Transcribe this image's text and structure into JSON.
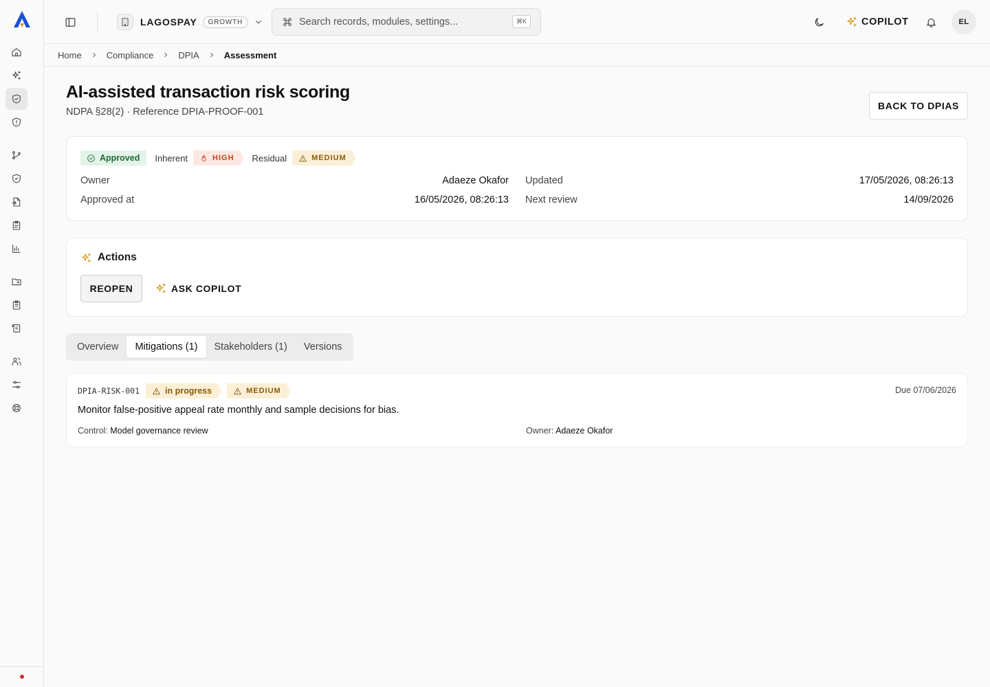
{
  "topbar": {
    "org_name": "LAGOSPAY",
    "org_plan": "GROWTH",
    "search_placeholder": "Search records, modules, settings...",
    "search_shortcut": "⌘K",
    "copilot_label": "COPILOT",
    "avatar_initials": "EL"
  },
  "breadcrumb": [
    "Home",
    "Compliance",
    "DPIA",
    "Assessment"
  ],
  "page": {
    "title": "AI-assisted transaction risk scoring",
    "subtitle": "NDPA §28(2) · Reference DPIA-PROOF-001",
    "back_label": "BACK TO DPIAS"
  },
  "summary": {
    "status": "Approved",
    "inherent_label": "Inherent",
    "inherent_value": "HIGH",
    "residual_label": "Residual",
    "residual_value": "MEDIUM",
    "owner_label": "Owner",
    "owner_value": "Adaeze Okafor",
    "updated_label": "Updated",
    "updated_value": "17/05/2026, 08:26:13",
    "approved_label": "Approved at",
    "approved_value": "16/05/2026, 08:26:13",
    "review_label": "Next review",
    "review_value": "14/09/2026"
  },
  "actions": {
    "title": "Actions",
    "reopen_label": "REOPEN",
    "ask_label": "ASK COPILOT"
  },
  "tabs": [
    "Overview",
    "Mitigations (1)",
    "Stakeholders (1)",
    "Versions"
  ],
  "active_tab": "Mitigations (1)",
  "mitigation": {
    "code": "DPIA-RISK-001",
    "status": "in progress",
    "severity": "MEDIUM",
    "due": "Due 07/06/2026",
    "description": "Monitor false-positive appeal rate monthly and sample decisions for bias.",
    "control_label": "Control:",
    "control_value": "Model governance review",
    "owner_label": "Owner:",
    "owner_value": "Adaeze Okafor"
  },
  "colors": {
    "brand_blue": "#1d4fd8",
    "brand_gold": "#d89a1c",
    "approved_bg": "#e3f3e7",
    "high_bg": "#fde8e1",
    "medium_bg": "#fbf0d7",
    "alert_dot": "#d32f2f"
  },
  "icons": {
    "rail": [
      "home-icon",
      "sparkles-icon",
      "shield-check-icon",
      "shield-icon",
      "git-branch-icon",
      "shield-check-icon",
      "file-import-icon",
      "clipboard-icon",
      "bar-chart-icon",
      "folder-icon",
      "clipboard-list-icon",
      "scroll-icon",
      "users-icon",
      "sliders-icon",
      "lifebuoy-icon"
    ]
  }
}
